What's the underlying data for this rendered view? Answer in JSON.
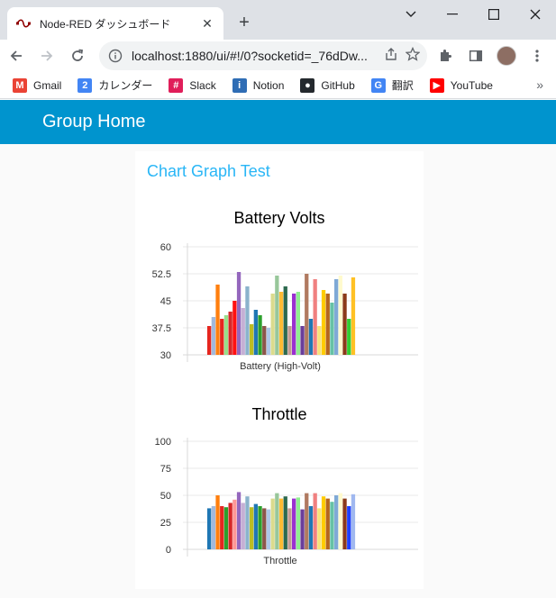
{
  "browser": {
    "tab_title": "Node-RED ダッシュボード",
    "tab_close": "✕",
    "new_tab": "+",
    "url": "localhost:1880/ui/#!/0?socketid=_76dDw...",
    "bookmarks": [
      {
        "label": "Gmail",
        "icon": "gmail-icon",
        "color": "#ea4335",
        "glyph": "M"
      },
      {
        "label": "カレンダー",
        "icon": "calendar-icon",
        "color": "#4285f4",
        "glyph": "2"
      },
      {
        "label": "Slack",
        "icon": "slack-icon",
        "color": "#e01e5a",
        "glyph": "#"
      },
      {
        "label": "Notion",
        "icon": "notion-icon",
        "color": "#2f6db5",
        "glyph": "i"
      },
      {
        "label": "GitHub",
        "icon": "github-icon",
        "color": "#24292e",
        "glyph": "●"
      },
      {
        "label": "翻訳",
        "icon": "translate-icon",
        "color": "#4285f4",
        "glyph": "G"
      },
      {
        "label": "YouTube",
        "icon": "youtube-icon",
        "color": "#ff0000",
        "glyph": "▶"
      }
    ],
    "bookmarks_more": "»"
  },
  "app": {
    "header_title": "Group Home",
    "group_title": "Chart Graph Test",
    "accent": "#0094ce",
    "group_title_color": "#29b6f6"
  },
  "chart_data": [
    {
      "type": "bar",
      "title": "Battery Volts",
      "xlabel": "",
      "ylabel": "",
      "categories": [
        "Battery (High-Volt)"
      ],
      "yticks": [
        "60",
        "52.5",
        "45",
        "37.5",
        "30"
      ],
      "ylim": [
        30,
        60
      ],
      "grid": true,
      "values": [
        38,
        40.5,
        49.5,
        40,
        41,
        42,
        45,
        53,
        43,
        49,
        38.5,
        42.5,
        41,
        38,
        37.5,
        47,
        52,
        47.5,
        49,
        38,
        47,
        47.5,
        38,
        52.5,
        40,
        51,
        38,
        48,
        47,
        44.5,
        51,
        52,
        47,
        40,
        51.5
      ],
      "colors": [
        "#e6261f",
        "#a2b9dc",
        "#ff7f0e",
        "#e6261f",
        "#98df8a",
        "#d62728",
        "#ff1010",
        "#9467bd",
        "#c5b0d5",
        "#8bb3cc",
        "#bcbd22",
        "#1f77b4",
        "#2ca02c",
        "#8c564b",
        "#aec7e8",
        "#dbdb8d",
        "#98c79a",
        "#ffbb33",
        "#2d6a4f",
        "#c49c94",
        "#9b30d0",
        "#90ee90",
        "#6a3d9a",
        "#b07a60",
        "#1f77b4",
        "#f08080",
        "#f7e27a",
        "#ffcc00",
        "#b5651d",
        "#66c2a5",
        "#7fa9d6",
        "#fffacd",
        "#8b3a1a",
        "#32cd32",
        "#ffc125"
      ]
    },
    {
      "type": "bar",
      "title": "Throttle",
      "xlabel": "",
      "ylabel": "",
      "categories": [
        "Throttle"
      ],
      "yticks": [
        "100",
        "75",
        "50",
        "25",
        "0"
      ],
      "ylim": [
        0,
        100
      ],
      "grid": true,
      "values": [
        38,
        40,
        50,
        40,
        39,
        43,
        46,
        53,
        43,
        49,
        39,
        42,
        40,
        38,
        37,
        47,
        52,
        47,
        49,
        38,
        47,
        48,
        37,
        52,
        40,
        52,
        38,
        49,
        47,
        44,
        50,
        52,
        47,
        40,
        51
      ],
      "colors": [
        "#1f77b4",
        "#a2b9dc",
        "#ff7f0e",
        "#e6261f",
        "#2ca02c",
        "#d62728",
        "#ff9896",
        "#9467bd",
        "#c5b0d5",
        "#8bb3cc",
        "#bcbd22",
        "#1f77b4",
        "#2ca02c",
        "#8c564b",
        "#aec7e8",
        "#dbdb8d",
        "#98c79a",
        "#ffbb33",
        "#2d6a4f",
        "#c49c94",
        "#9b30d0",
        "#90ee90",
        "#6a3d9a",
        "#b07a60",
        "#1f77b4",
        "#f08080",
        "#f7e27a",
        "#ffcc00",
        "#b5651d",
        "#66c2a5",
        "#7fa9d6",
        "#fffacd",
        "#8b3a1a",
        "#1e40ff",
        "#a0b8f0"
      ]
    }
  ]
}
